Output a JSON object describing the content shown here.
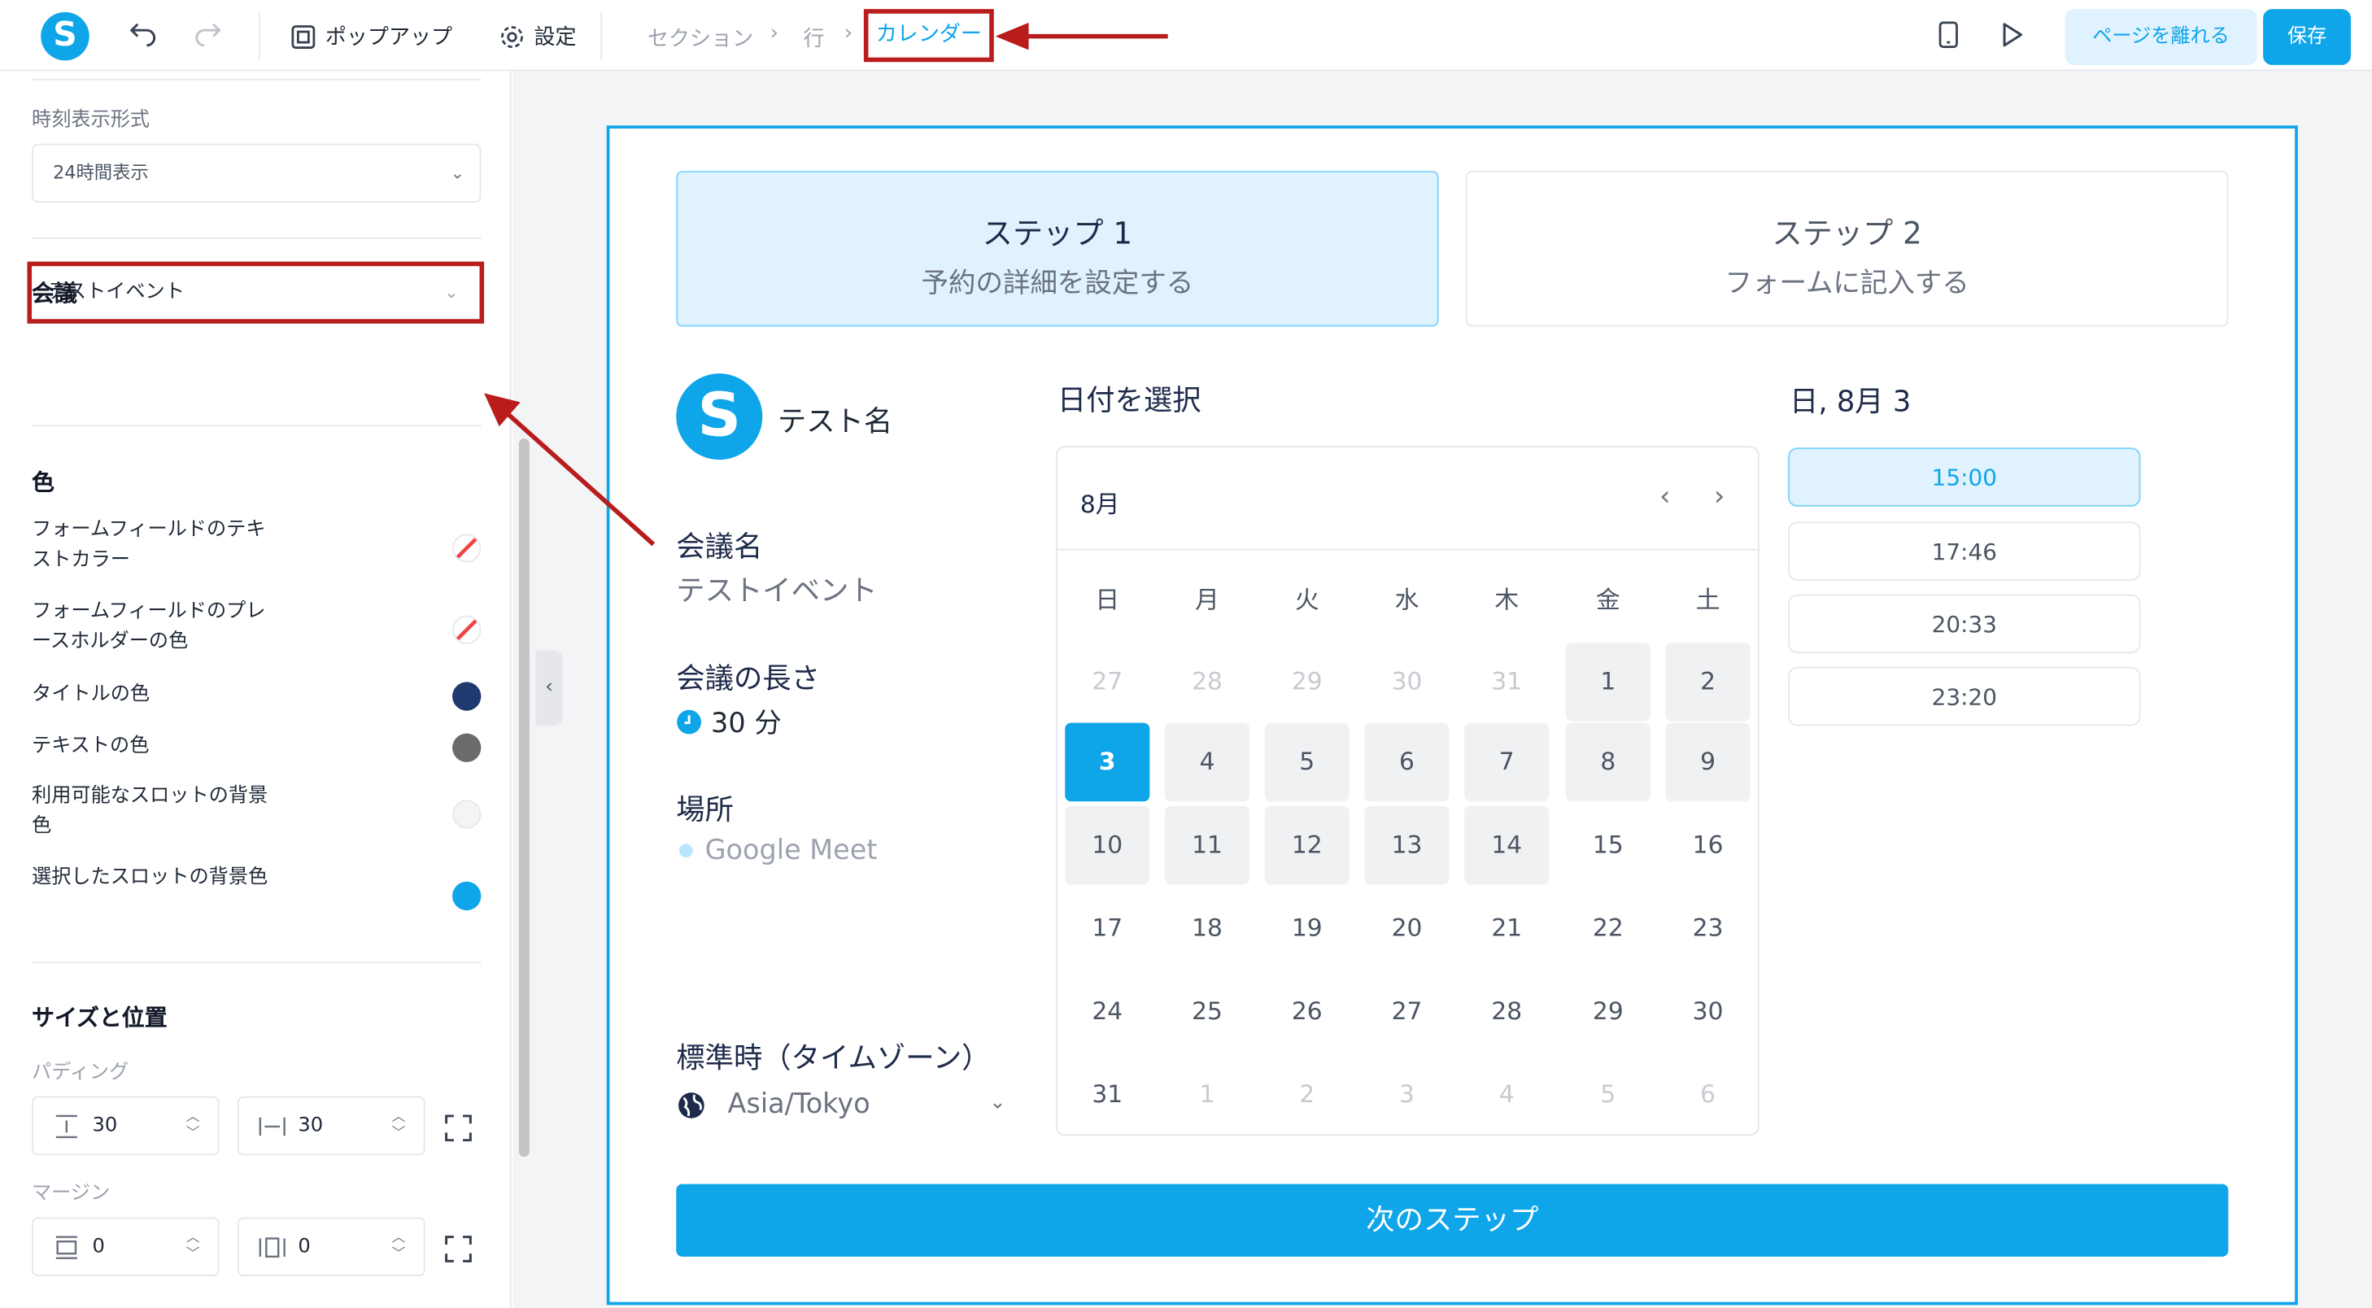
{
  "topbar": {
    "logo": "S",
    "undo_icon": "undo-icon",
    "redo_icon": "redo-icon",
    "popup_label": "ポップアップ",
    "settings_label": "設定",
    "breadcrumb": [
      "セクション",
      "行"
    ],
    "breadcrumb_active": "カレンダー",
    "leave_label": "ページを離れる",
    "save_label": "保存"
  },
  "panel": {
    "time_format_label": "時刻表示形式",
    "time_format_value": "24時間表示",
    "meeting_heading": "会議",
    "meeting_value": "テストイベント",
    "color_heading": "色",
    "colors": [
      {
        "label": "フォームフィールドのテキストカラー",
        "value": "none"
      },
      {
        "label": "フォームフィールドのプレースホルダーの色",
        "value": "none"
      },
      {
        "label": "タイトルの色",
        "value": "#1e3a6e"
      },
      {
        "label": "テキストの色",
        "value": "#6b6b6b"
      },
      {
        "label": "利用可能なスロットの背景色",
        "value": "#f3f4f6"
      },
      {
        "label": "選択したスロットの背景色",
        "value": "#0ea5e9"
      }
    ],
    "size_heading": "サイズと位置",
    "padding_label": "パディング",
    "padding_vertical": "30",
    "padding_horizontal": "30",
    "margin_label": "マージン",
    "margin_vertical": "0",
    "margin_horizontal": "0"
  },
  "preview": {
    "step1_title": "ステップ 1",
    "step1_sub": "予約の詳細を設定する",
    "step2_title": "ステップ 2",
    "step2_sub": "フォームに記入する",
    "avatar": "S",
    "host_name": "テスト名",
    "meeting_name_label": "会議名",
    "meeting_name": "テストイベント",
    "duration_label": "会議の長さ",
    "duration": "30 分",
    "location_label": "場所",
    "location": "Google Meet",
    "timezone_label": "標準時（タイムゾーン）",
    "timezone": "Asia/Tokyo",
    "date_heading": "日付を選択",
    "month": "8月",
    "weekdays": [
      "日",
      "月",
      "火",
      "水",
      "木",
      "金",
      "土"
    ],
    "weeks": [
      [
        "27",
        "28",
        "29",
        "30",
        "31",
        "1",
        "2"
      ],
      [
        "3",
        "4",
        "5",
        "6",
        "7",
        "8",
        "9"
      ],
      [
        "10",
        "11",
        "12",
        "13",
        "14",
        "15",
        "16"
      ],
      [
        "17",
        "18",
        "19",
        "20",
        "21",
        "22",
        "23"
      ],
      [
        "24",
        "25",
        "26",
        "27",
        "28",
        "29",
        "30"
      ],
      [
        "31",
        "1",
        "2",
        "3",
        "4",
        "5",
        "6"
      ]
    ],
    "selected_day": "3",
    "slots_heading": "日, 8月 3",
    "slots": [
      "15:00",
      "17:46",
      "20:33",
      "23:20"
    ],
    "selected_slot": "15:00",
    "next_label": "次のステップ"
  },
  "accent_color": "#0ea5e9",
  "annotation_color": "#b91c1c"
}
